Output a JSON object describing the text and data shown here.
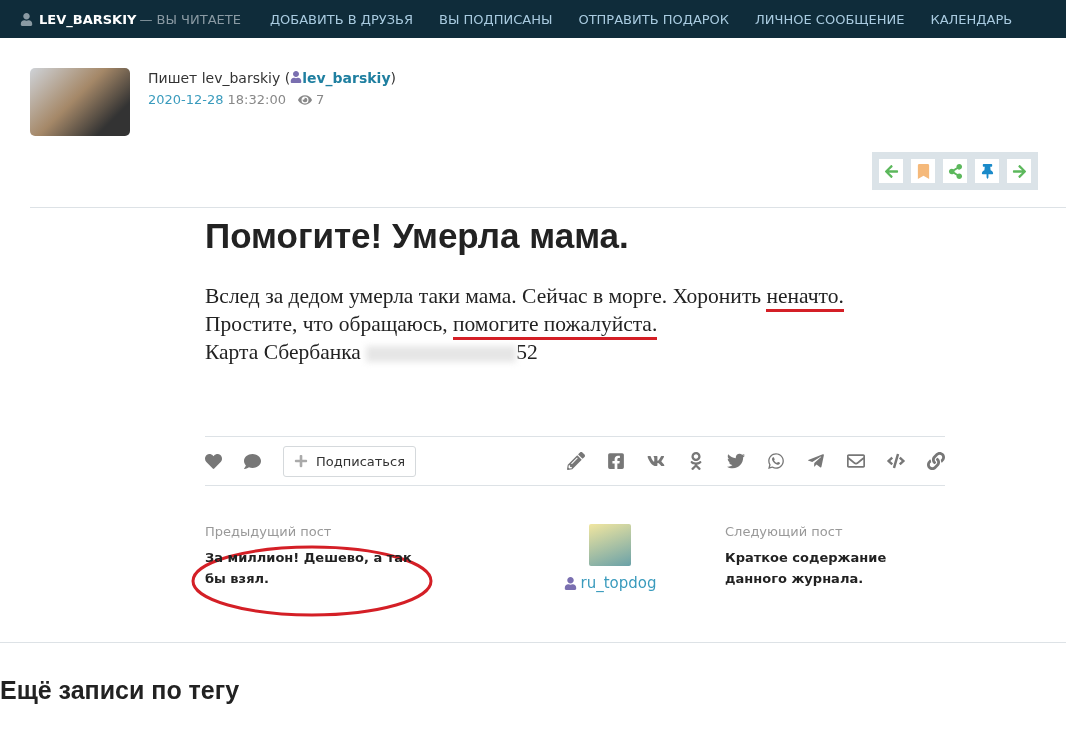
{
  "top_bar": {
    "username": "LEV_BARSKIY",
    "status": "— ВЫ ЧИТАЕТЕ",
    "links": [
      "ДОБАВИТЬ В ДРУЗЬЯ",
      "ВЫ ПОДПИСАНЫ",
      "ОТПРАВИТЬ ПОДАРОК",
      "ЛИЧНОЕ СООБЩЕНИЕ",
      "КАЛЕНДАРЬ"
    ]
  },
  "author": {
    "prefix": "Пишет lev_barskiy (",
    "user": "lev_barskiy",
    "suffix": ")",
    "date": "2020-12-28",
    "time": "18:32:00",
    "views": "7"
  },
  "post_tools": [
    {
      "kind": "prev"
    },
    {
      "kind": "bookmark"
    },
    {
      "kind": "share"
    },
    {
      "kind": "pin"
    },
    {
      "kind": "next"
    }
  ],
  "post": {
    "title": "Помогите! Умерла мама.",
    "lines": [
      [
        {
          "text": "Вслед за дедом умерла таки мама. Сейчас в морге. Хоронить ",
          "annotated": false
        },
        {
          "text": "неначто.",
          "annotated": true
        }
      ],
      [
        {
          "text": "Простите, что обращаюсь, ",
          "annotated": false
        },
        {
          "text": "помогите пожалуйста.",
          "annotated": true
        }
      ],
      [
        {
          "text": "Карта Сбербанка ",
          "annotated": false
        },
        {
          "kind": "blurred"
        },
        {
          "text": "52",
          "annotated": false
        }
      ]
    ]
  },
  "actions": {
    "subscribe": "Подписаться",
    "share": [
      {
        "kind": "lj"
      },
      {
        "kind": "facebook"
      },
      {
        "kind": "vk"
      },
      {
        "kind": "ok"
      },
      {
        "kind": "twitter"
      },
      {
        "kind": "whatsapp"
      },
      {
        "kind": "telegram"
      },
      {
        "kind": "email"
      },
      {
        "kind": "embed"
      },
      {
        "kind": "link"
      }
    ]
  },
  "nav": {
    "prev": {
      "label": "Предыдущий пост",
      "title": "За миллион! Дешево, а так бы взял.",
      "circled": true
    },
    "journal": "ru_topdog",
    "next": {
      "label": "Следующий пост",
      "title": "Краткое содержание данного журнала."
    }
  },
  "tag_section": {
    "title": "Ещё записи по тегу"
  }
}
